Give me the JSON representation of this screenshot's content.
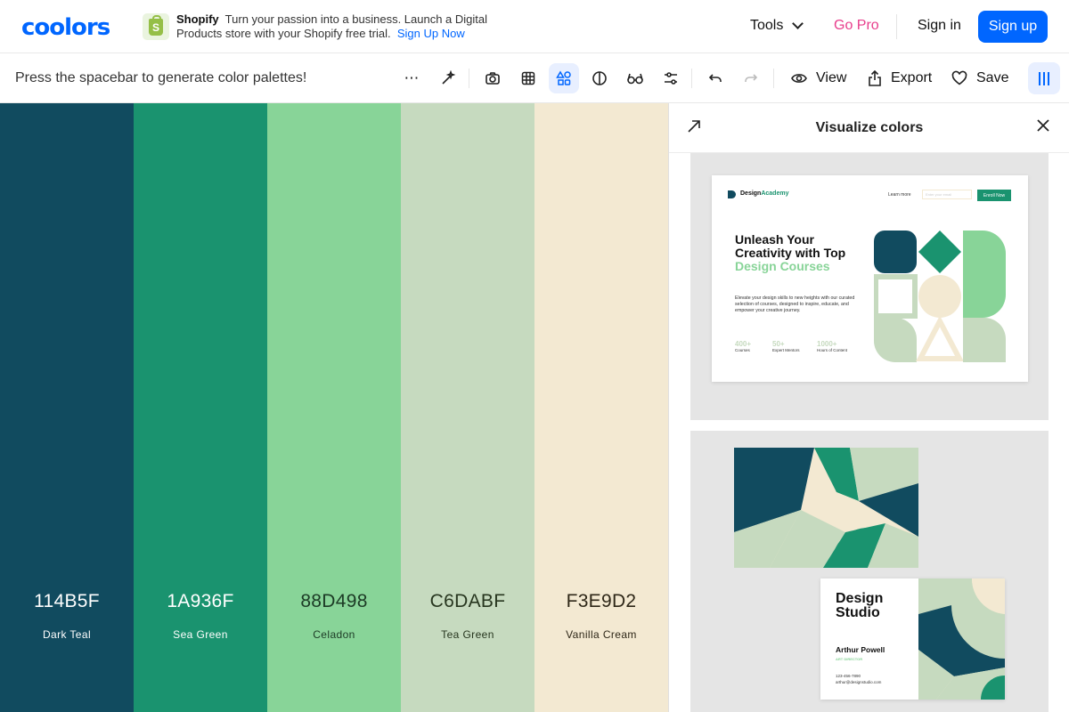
{
  "nav": {
    "logo": "coolors",
    "ad": {
      "brand": "Shopify",
      "text": "Turn your passion into a business. Launch a Digital Products store with your Shopify free trial.",
      "link": "Sign Up Now"
    },
    "tools": "Tools",
    "go_pro": "Go Pro",
    "sign_in": "Sign in",
    "sign_up": "Sign up"
  },
  "toolbar": {
    "hint": "Press the spacebar to generate color palettes!",
    "view": "View",
    "export": "Export",
    "save": "Save"
  },
  "palette": [
    {
      "hex": "114B5F",
      "name": "Dark Teal",
      "bg": "#114b5f",
      "fg": "#ffffff"
    },
    {
      "hex": "1A936F",
      "name": "Sea Green",
      "bg": "#1a936f",
      "fg": "#ffffff"
    },
    {
      "hex": "88D498",
      "name": "Celadon",
      "bg": "#88d498",
      "fg": "#1c3a25"
    },
    {
      "hex": "C6DABF",
      "name": "Tea Green",
      "bg": "#c6dabf",
      "fg": "#27361f"
    },
    {
      "hex": "F3E9D2",
      "name": "Vanilla Cream",
      "bg": "#f3e9d2",
      "fg": "#2e2718"
    }
  ],
  "panel": {
    "title": "Visualize colors",
    "website": {
      "logo_a": "Design",
      "logo_b": "Academy",
      "learn": "Learn more",
      "email_placeholder": "Enter your email",
      "cta": "Enroll Now",
      "headline_a": "Unleash Your Creativity with Top",
      "headline_b": "Design Courses",
      "body": "Elevate your design skills to new heights with our curated selection of courses, designed to inspire, educate, and empower your creative journey.",
      "stats": [
        {
          "value": "400+",
          "label": "Courses"
        },
        {
          "value": "50+",
          "label": "Expert Mentors"
        },
        {
          "value": "1000+",
          "label": "Hours of Content"
        }
      ]
    },
    "card": {
      "title_a": "Design",
      "title_b": "Studio",
      "name": "Arthur Powell",
      "role": "ART DIRECTOR",
      "phone": "123-456-7890",
      "email": "arthur@designstudio.com"
    }
  }
}
